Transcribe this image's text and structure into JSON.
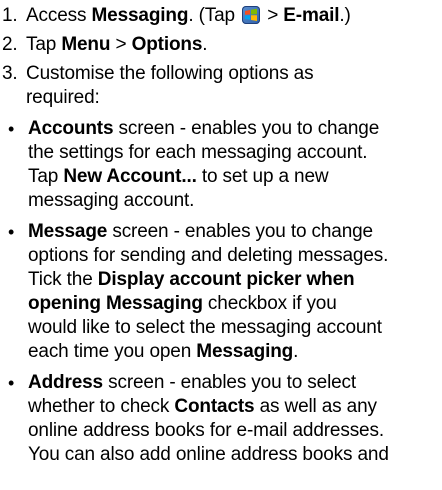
{
  "steps": [
    {
      "num": "1.",
      "pre": "Access ",
      "bold": "Messaging",
      "mid": ".  (Tap ",
      "icon": "windows-start-icon",
      "post": " > ",
      "bold2": "E-mail",
      "end": ".)"
    },
    {
      "num": "2.",
      "pre": "Tap ",
      "bold": "Menu",
      "mid": " > ",
      "bold2": "Options",
      "end": "."
    },
    {
      "num": "3.",
      "line1": "Customise the following options as",
      "line2": "required:"
    }
  ],
  "bullets": [
    {
      "line1_bold": "Accounts",
      "line1_rest": " screen - enables you to change",
      "line2": "the settings for each messaging account.",
      "line3_pre": "Tap ",
      "line3_bold": "New Account...",
      "line3_post": " to set up a new",
      "line4": "messaging account."
    },
    {
      "line1_bold": "Message",
      "line1_rest": " screen - enables you to change",
      "line2": "options for sending and deleting messages.",
      "line3_pre": "Tick the ",
      "line3_bold": "Display account picker when",
      "line4_bold": "opening Messaging",
      "line4_post": " checkbox if you",
      "line5": "would like to select the messaging account",
      "line6_pre": "each time you open ",
      "line6_bold": "Messaging",
      "line6_post": "."
    },
    {
      "line1_bold": "Address",
      "line1_rest": " screen - enables you to select",
      "line2_pre": "whether to check ",
      "line2_bold": "Contacts",
      "line2_post": " as well as any",
      "line3": "online address books for e-mail addresses.",
      "line4": "You can also add online address books and"
    }
  ],
  "bullet_char": "•"
}
